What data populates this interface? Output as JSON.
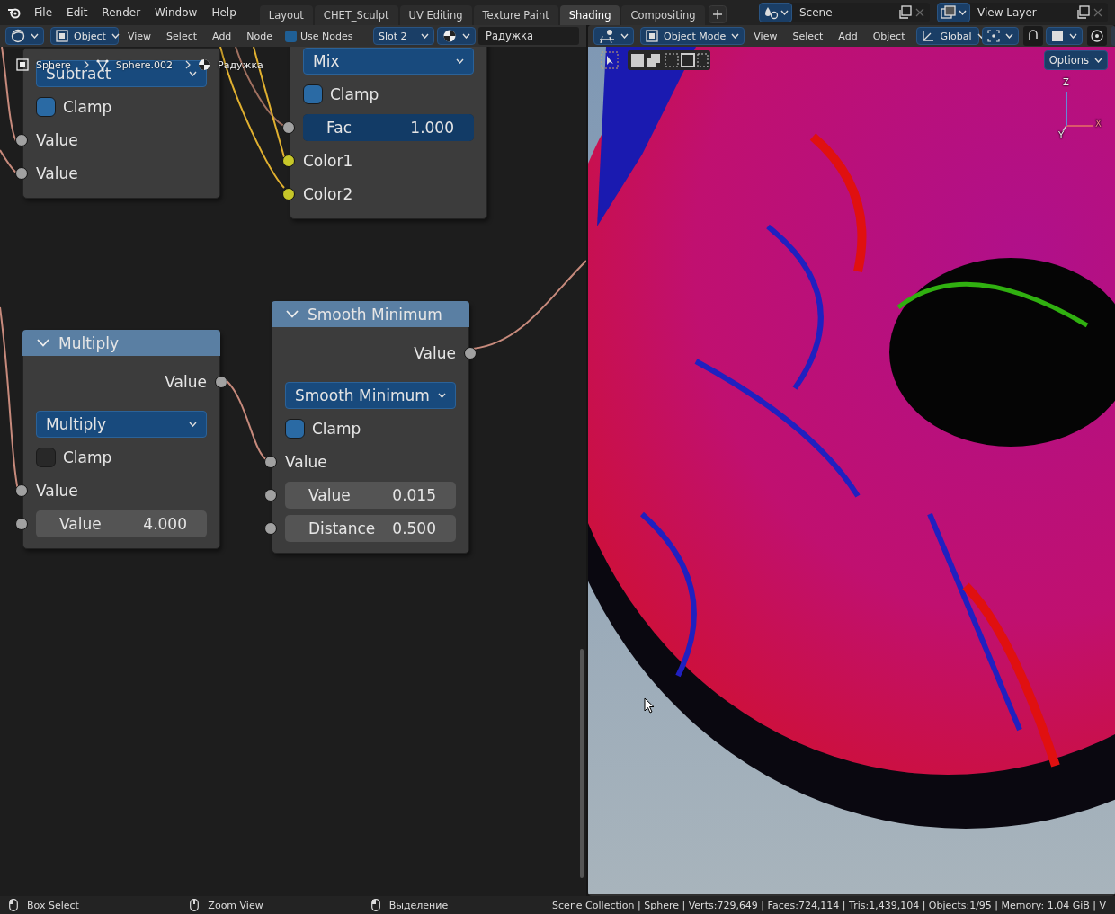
{
  "menu": [
    "File",
    "Edit",
    "Render",
    "Window",
    "Help"
  ],
  "workspace_tabs": [
    {
      "label": "Layout",
      "selected": false
    },
    {
      "label": "CHET_Sculpt",
      "selected": false
    },
    {
      "label": "UV Editing",
      "selected": false
    },
    {
      "label": "Texture Paint",
      "selected": false
    },
    {
      "label": "Shading",
      "selected": true
    },
    {
      "label": "Compositing",
      "selected": false
    }
  ],
  "scene": "Scene",
  "view_layer": "View Layer",
  "node_editor": {
    "header": {
      "mode": "Object",
      "menus": [
        "View",
        "Select",
        "Add",
        "Node"
      ],
      "use_nodes": {
        "label": "Use Nodes",
        "checked": true
      },
      "slot": "Slot 2",
      "material": "Радужка"
    },
    "breadcrumbs": [
      "Sphere",
      "Sphere.002",
      "Радужка"
    ],
    "nodes": [
      {
        "rows": [
          {
            "kind": "dropdown",
            "label": "Subtract"
          },
          {
            "kind": "checkbox",
            "label": "Clamp",
            "checked": true
          },
          {
            "kind": "input",
            "label": "Value",
            "color": "#a1a1a1"
          },
          {
            "kind": "input",
            "label": "Value",
            "color": "#a1a1a1"
          }
        ]
      },
      {
        "rows": [
          {
            "kind": "dropdown",
            "label": "Mix"
          },
          {
            "kind": "checkbox",
            "label": "Clamp",
            "checked": true
          },
          {
            "kind": "field",
            "label": "Fac",
            "value": "1.000",
            "color": "#a1a1a1",
            "level": 1
          },
          {
            "kind": "input",
            "label": "Color1",
            "color": "#c7c729"
          },
          {
            "kind": "input",
            "label": "Color2",
            "color": "#c7c729"
          }
        ]
      },
      {
        "title": "Multiply",
        "rows": [
          {
            "kind": "output",
            "label": "Value",
            "color": "#a1a1a1"
          },
          {
            "kind": "dropdown",
            "label": "Multiply"
          },
          {
            "kind": "checkbox",
            "label": "Clamp",
            "checked": false
          },
          {
            "kind": "input",
            "label": "Value",
            "color": "#a1a1a1"
          },
          {
            "kind": "field",
            "label": "Value",
            "value": "4.000",
            "color": "#a1a1a1"
          }
        ]
      },
      {
        "title": "Smooth Minimum",
        "rows": [
          {
            "kind": "output",
            "label": "Value",
            "color": "#a1a1a1"
          },
          {
            "kind": "dropdown",
            "label": "Smooth Minimum"
          },
          {
            "kind": "checkbox",
            "label": "Clamp",
            "checked": true
          },
          {
            "kind": "input",
            "label": "Value",
            "color": "#a1a1a1"
          },
          {
            "kind": "field",
            "label": "Value",
            "value": "0.015",
            "color": "#a1a1a1"
          },
          {
            "kind": "field",
            "label": "Distance",
            "value": "0.500",
            "color": "#a1a1a1"
          }
        ]
      }
    ]
  },
  "viewport": {
    "header": {
      "mode": "Object Mode",
      "menus": [
        "View",
        "Select",
        "Add",
        "Object"
      ],
      "orientation": "Global"
    },
    "options": "Options",
    "gizmo": [
      "Z",
      "X",
      "Y"
    ]
  },
  "status_bar": {
    "hints": [
      "Box Select",
      "Zoom View",
      "Выделение"
    ],
    "stats": "Scene Collection | Sphere | Verts:729,649 | Faces:724,114 | Tris:1,439,104 | Objects:1/95 | Memory: 1.04 GiB | V"
  }
}
